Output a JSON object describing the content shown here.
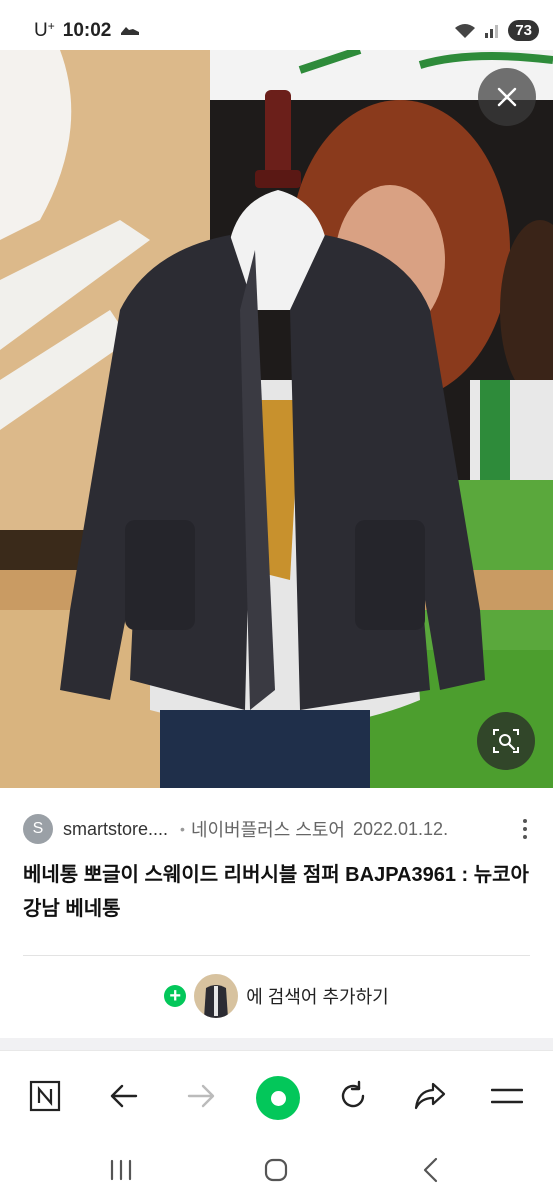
{
  "status_bar": {
    "carrier": "U",
    "carrier_sup": "+",
    "time": "10:02",
    "battery": "73"
  },
  "image_viewer": {
    "close_icon": "close-icon",
    "lens_icon": "image-search-icon"
  },
  "result": {
    "source_avatar_letter": "S",
    "source_domain": "smartstore....",
    "source_site": "네이버플러스 스토어",
    "date": "2022.01.12.",
    "title": "베네통 뽀글이 스웨이드 리버시블 점퍼 BAJPA3961 : 뉴코아 강남 베네통",
    "add_search_text": "에 검색어 추가하기"
  },
  "toolbar": {
    "items": [
      "naver-n-icon",
      "back-arrow-icon",
      "forward-arrow-icon",
      "home-icon",
      "refresh-icon",
      "share-icon",
      "menu-icon"
    ]
  },
  "colors": {
    "naver_green": "#03c75a",
    "jacket": "#2c2c33"
  }
}
